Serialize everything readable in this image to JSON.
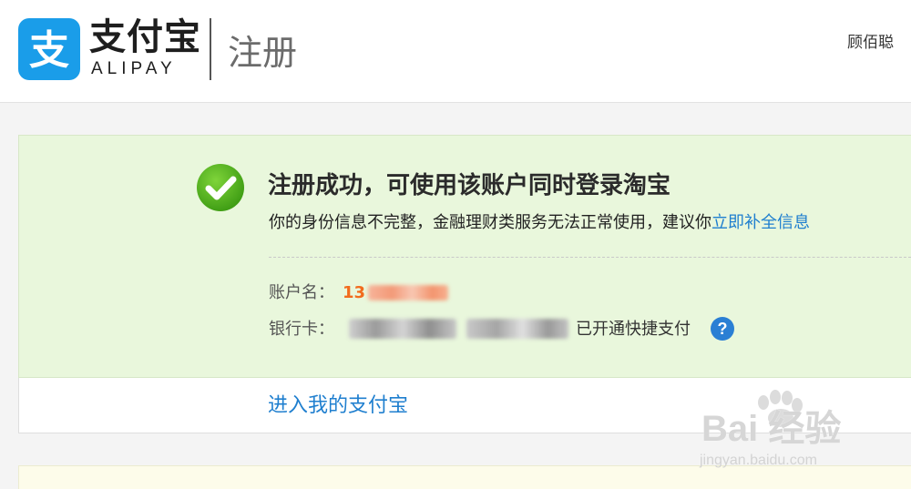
{
  "header": {
    "logo_name": "支付宝",
    "logo_sub": "ALIPAY",
    "page_title": "注册",
    "user_name": "顾佰聪"
  },
  "success": {
    "title": "注册成功，可使用该账户同时登录淘宝",
    "info_text": "你的身份信息不完整，金融理财类服务无法正常使用，建议你",
    "info_link": "立即补全信息",
    "account_label": "账户名：",
    "account_value": "13",
    "card_label": "银行卡：",
    "card_status": "已开通快捷支付",
    "help_icon": "?"
  },
  "links": {
    "enter_label": "进入我的支付宝"
  },
  "watermark": {
    "text": "Bai 经验",
    "url": "jingyan.baidu.com"
  },
  "colors": {
    "accent": "#1f7fcf",
    "brand": "#1a9de9",
    "success_bg": "#e9f7dc",
    "account_value": "#f26b1d",
    "check": "#4cae1d"
  }
}
